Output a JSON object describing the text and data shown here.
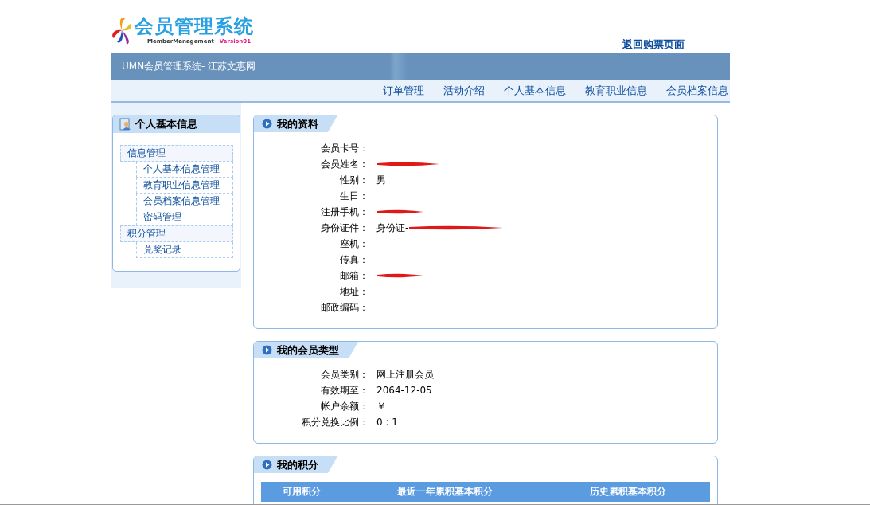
{
  "logo": {
    "title": "会员管理系统",
    "subtitle": "MemberManagement",
    "version": "Version01"
  },
  "top_link": "返回购票页面",
  "banner_title": "UMN会员管理系统- 江苏文惠网",
  "nav": [
    "订单管理",
    "活动介绍",
    "个人基本信息",
    "教育职业信息",
    "会员档案信息"
  ],
  "sidebar": {
    "title": "个人基本信息",
    "groups": [
      {
        "label": "信息管理",
        "children": [
          {
            "label": "个人基本信息管理"
          },
          {
            "label": "教育职业信息管理"
          },
          {
            "label": "会员档案信息管理"
          },
          {
            "label": "密码管理"
          }
        ]
      },
      {
        "label": "积分管理",
        "children": [
          {
            "label": "兑奖记录"
          }
        ]
      }
    ]
  },
  "panels": [
    {
      "kind": "fields",
      "title": "我的资料",
      "fields": [
        {
          "label": "会员卡号：",
          "redacted": false
        },
        {
          "label": "会员姓名：",
          "redacted": true
        },
        {
          "label": "性别：",
          "value": "男",
          "redacted": false
        },
        {
          "label": "生日：",
          "redacted": false
        },
        {
          "label": "注册手机：",
          "redacted": true
        },
        {
          "label": "身份证件：",
          "value": "身份证-",
          "redacted": true
        },
        {
          "label": "座机：",
          "redacted": false
        },
        {
          "label": "传真：",
          "redacted": false
        },
        {
          "label": "邮箱：",
          "redacted": true
        },
        {
          "label": "地址：",
          "redacted": false
        },
        {
          "label": "邮政编码：",
          "redacted": false
        }
      ]
    },
    {
      "kind": "fields",
      "title": "我的会员类型",
      "fields": [
        {
          "label": "会员类别：",
          "value": "网上注册会员",
          "redacted": false
        },
        {
          "label": "有效期至：",
          "value": "2064-12-05",
          "redacted": false
        },
        {
          "label": "帐户余额：",
          "value": "￥",
          "redacted": false
        },
        {
          "label": "积分兑换比例：",
          "value": "0 : 1",
          "redacted": false
        }
      ]
    },
    {
      "kind": "table",
      "title": "我的积分",
      "columns": [
        "可用积分",
        "最近一年累积基本积分",
        "历史累积基本积分"
      ]
    }
  ]
}
